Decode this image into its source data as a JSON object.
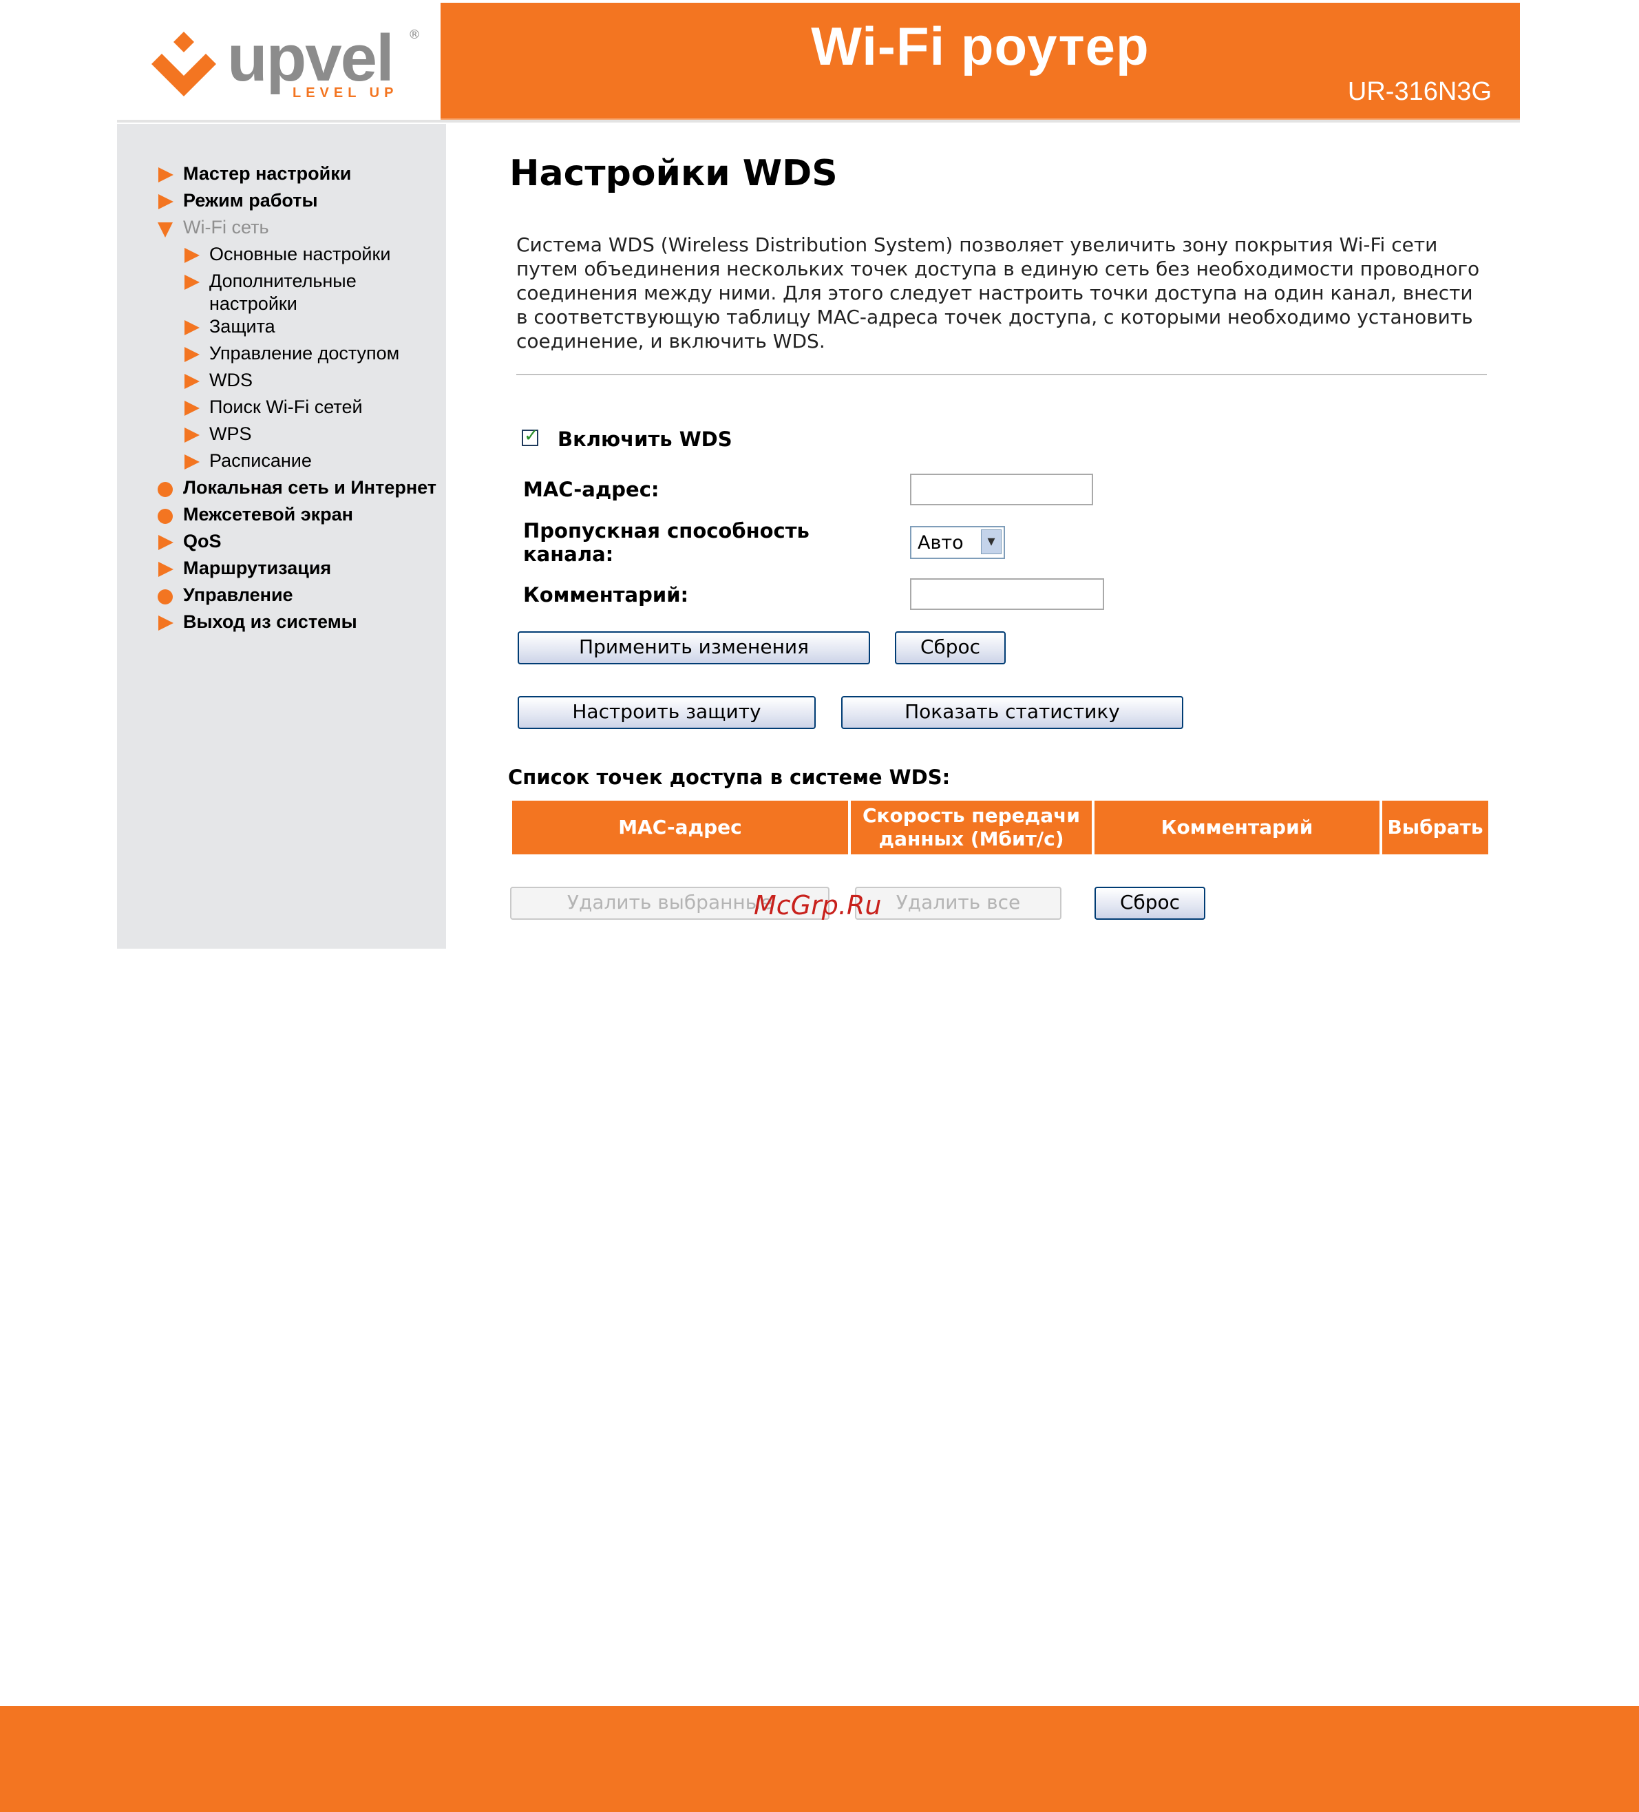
{
  "brand": {
    "name": "upvel",
    "tagline": "LEVEL UP",
    "reg": "®",
    "accent": "#f37521"
  },
  "header": {
    "title": "Wi-Fi роутер",
    "model": "UR-316N3G"
  },
  "sidebar": {
    "items": [
      {
        "label": "Мастер настройки",
        "icon": "triangle-right-icon"
      },
      {
        "label": "Режим работы",
        "icon": "triangle-right-icon"
      },
      {
        "label": "Wi-Fi сеть",
        "icon": "triangle-down-icon"
      },
      {
        "label": "Основные настройки",
        "icon": "triangle-right-icon"
      },
      {
        "label": "Дополнительные",
        "label2": "настройки",
        "icon": "triangle-right-icon"
      },
      {
        "label": "Защита",
        "icon": "triangle-right-icon"
      },
      {
        "label": "Управление доступом",
        "icon": "triangle-right-icon"
      },
      {
        "label": "WDS",
        "icon": "triangle-right-icon"
      },
      {
        "label": "Поиск Wi-Fi сетей",
        "icon": "triangle-right-icon"
      },
      {
        "label": "WPS",
        "icon": "triangle-right-icon"
      },
      {
        "label": "Расписание",
        "icon": "triangle-right-icon"
      },
      {
        "label": "Локальная сеть и Интернет",
        "icon": "dot-icon"
      },
      {
        "label": "Межсетевой экран",
        "icon": "dot-icon"
      },
      {
        "label": "QoS",
        "icon": "triangle-right-icon"
      },
      {
        "label": "Маршрутизация",
        "icon": "triangle-right-icon"
      },
      {
        "label": "Управление",
        "icon": "dot-icon"
      },
      {
        "label": "Выход из системы",
        "icon": "triangle-right-icon"
      }
    ]
  },
  "main": {
    "title": "Настройки WDS",
    "intro_lines": [
      "Система WDS (Wireless Distribution System) позволяет увеличить зону покрытия Wi-Fi сети",
      "путем объединения нескольких точек доступа в единую сеть без необходимости проводного",
      "соединения между ними. Для этого следует настроить точки доступа на один канал, внести",
      "в соответствующую таблицу MAC-адреса точек доступа, с которыми необходимо установить",
      "соединение, и включить WDS."
    ],
    "enable_wds": {
      "label": "Включить WDS",
      "checked": true,
      "checkmark": "✓"
    },
    "mac": {
      "label": "MAC-адрес:",
      "value": ""
    },
    "bandwidth": {
      "label_line1": "Пропускная способность",
      "label_line2": "канала:",
      "selected": "Авто",
      "arrow": "▾"
    },
    "comment": {
      "label": "Комментарий:",
      "value": ""
    },
    "buttons": {
      "apply": "Применить изменения",
      "reset": "Сброс",
      "security": "Настроить защиту",
      "stats": "Показать статистику"
    },
    "list": {
      "title": "Список точек доступа в системе WDS:",
      "headers": {
        "mac": "MAC-адрес",
        "speed_line1": "Скорость передачи",
        "speed_line2": "данных (Мбит/с)",
        "comment": "Комментарий",
        "select": "Выбрать"
      },
      "delete_selected": "Удалить выбранные",
      "delete_all": "Удалить все",
      "reset": "Сброс"
    }
  },
  "watermark": "McGrp.Ru"
}
